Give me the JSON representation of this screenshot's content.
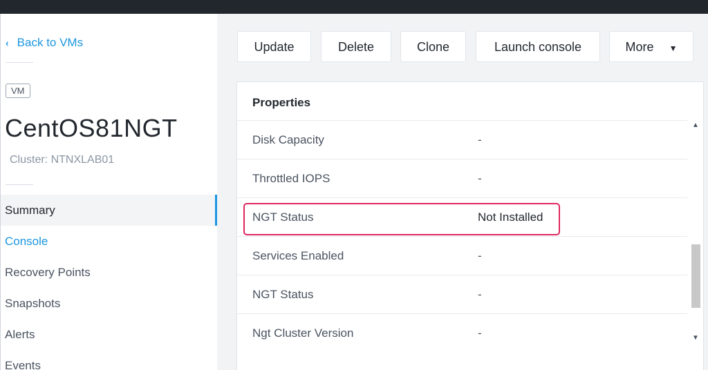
{
  "sidebar": {
    "back_label": "Back to VMs",
    "back_icon": "chevron-left-icon",
    "badge": "VM",
    "vm_name": "CentOS81NGT",
    "cluster_label": "Cluster: NTNXLAB01",
    "nav": [
      {
        "label": "Summary",
        "state": "active"
      },
      {
        "label": "Console",
        "state": "link"
      },
      {
        "label": "Recovery Points",
        "state": "normal"
      },
      {
        "label": "Snapshots",
        "state": "normal"
      },
      {
        "label": "Alerts",
        "state": "normal"
      },
      {
        "label": "Events",
        "state": "normal"
      }
    ]
  },
  "toolbar": {
    "update_label": "Update",
    "delete_label": "Delete",
    "clone_label": "Clone",
    "launch_console_label": "Launch console",
    "more_label": "More",
    "more_icon": "chevron-down-icon"
  },
  "properties": {
    "title": "Properties",
    "rows": [
      {
        "key": "Disk Capacity",
        "value": "-"
      },
      {
        "key": "Throttled IOPS",
        "value": "-"
      },
      {
        "key": "NGT Status",
        "value": "Not Installed"
      },
      {
        "key": "Services Enabled",
        "value": "-"
      },
      {
        "key": "NGT Status",
        "value": "-"
      },
      {
        "key": "Ngt Cluster Version",
        "value": "-"
      }
    ],
    "highlight_color": "#e0245e"
  },
  "colors": {
    "accent": "#1b96e0",
    "topbar": "#22272e",
    "main_bg": "#f1f3f5"
  }
}
